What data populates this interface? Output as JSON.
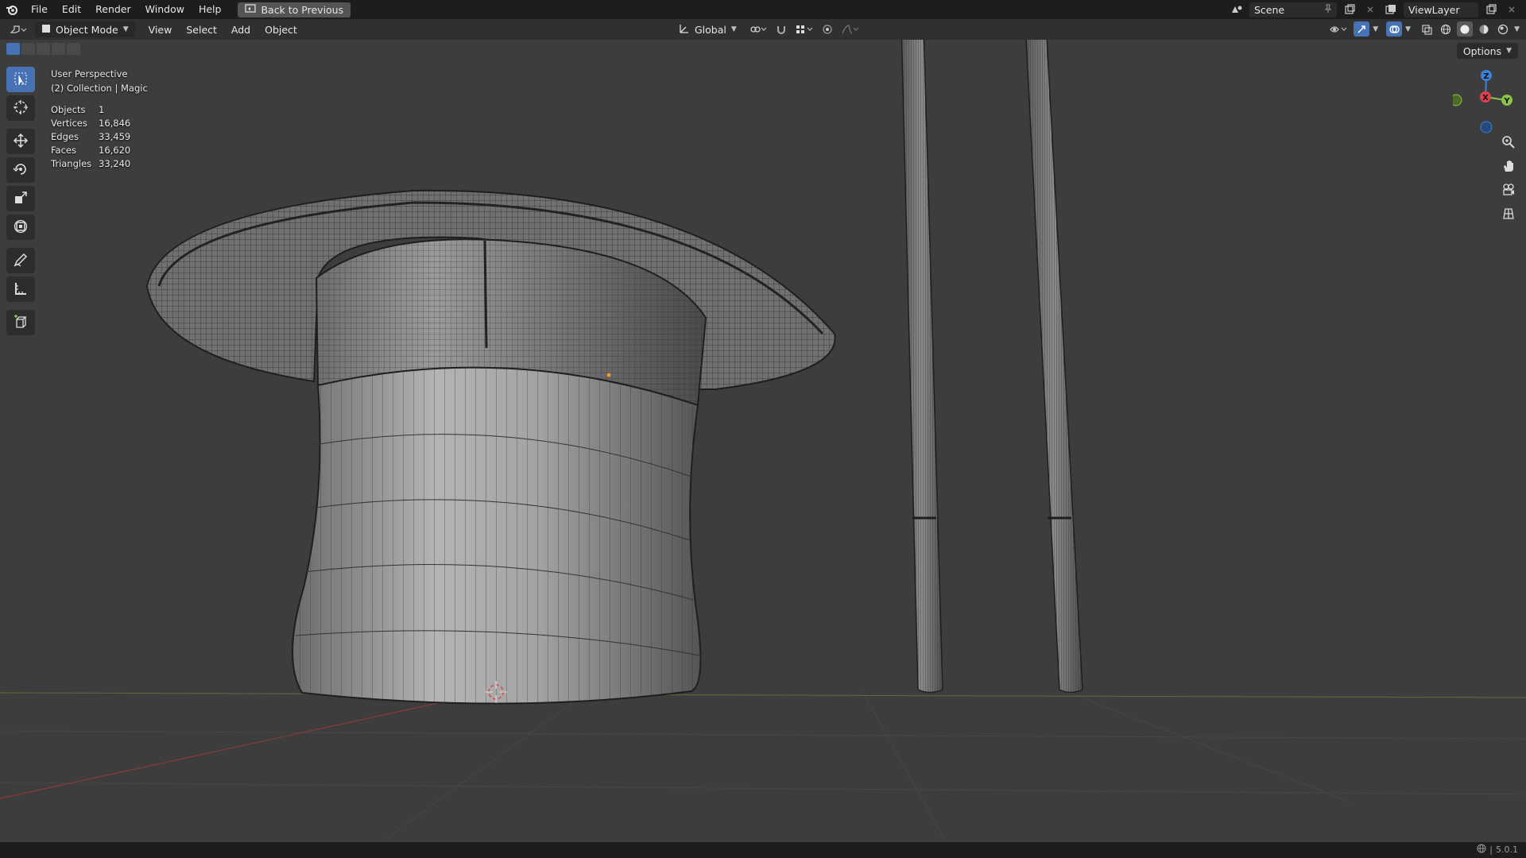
{
  "topbar": {
    "menu": [
      "File",
      "Edit",
      "Render",
      "Window",
      "Help"
    ],
    "back_button": "Back to Previous",
    "scene_name": "Scene",
    "viewlayer_name": "ViewLayer"
  },
  "viewport_header": {
    "mode": "Object Mode",
    "menu": [
      "View",
      "Select",
      "Add",
      "Object"
    ],
    "transform_orientation": "Global"
  },
  "overlay": {
    "view_name": "User Perspective",
    "collection": "(2) Collection | Magic",
    "stats": [
      {
        "label": "Objects",
        "value": "1"
      },
      {
        "label": "Vertices",
        "value": "16,846"
      },
      {
        "label": "Edges",
        "value": "33,459"
      },
      {
        "label": "Faces",
        "value": "16,620"
      },
      {
        "label": "Triangles",
        "value": "33,240"
      }
    ]
  },
  "options_label": "Options",
  "gizmo": {
    "x": "X",
    "y": "Y",
    "z": "Z"
  },
  "status": {
    "version": "5.0.1"
  },
  "colors": {
    "accent": "#4772b3",
    "axis_x": "#e0404f",
    "axis_y": "#8bc34a",
    "axis_z": "#3b82d8"
  }
}
